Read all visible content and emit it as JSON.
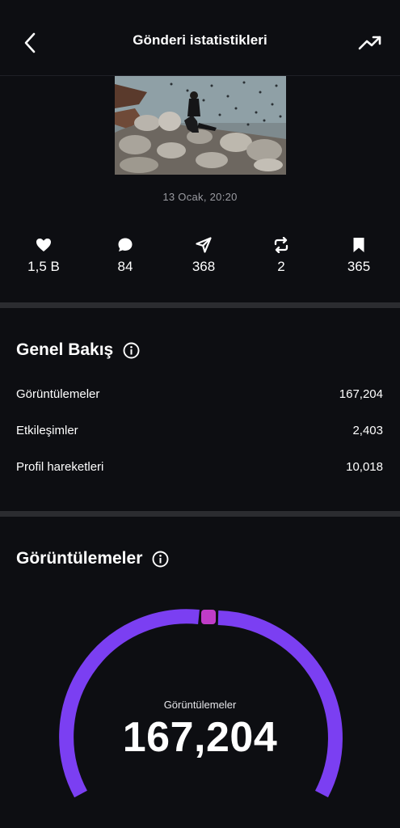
{
  "header": {
    "title": "Gönderi istatistikleri",
    "back_icon": "chevron-left-icon",
    "trend_icon": "trending-up-icon"
  },
  "post": {
    "date": "13 Ocak, 20:20"
  },
  "engagement": [
    {
      "icon": "heart-icon",
      "value": "1,5 B"
    },
    {
      "icon": "comment-icon",
      "value": "84"
    },
    {
      "icon": "send-icon",
      "value": "368"
    },
    {
      "icon": "repost-icon",
      "value": "2"
    },
    {
      "icon": "bookmark-icon",
      "value": "365"
    }
  ],
  "overview": {
    "title": "Genel Bakış",
    "rows": [
      {
        "label": "Görüntülemeler",
        "value": "167,204"
      },
      {
        "label": "Etkileşimler",
        "value": "2,403"
      },
      {
        "label": "Profil hareketleri",
        "value": "10,018"
      }
    ]
  },
  "views": {
    "title": "Görüntülemeler",
    "gauge_label": "Görüntülemeler",
    "gauge_value": "167,204",
    "colors": {
      "primary": "#7b3ff2",
      "secondary": "#c03cc8"
    }
  }
}
